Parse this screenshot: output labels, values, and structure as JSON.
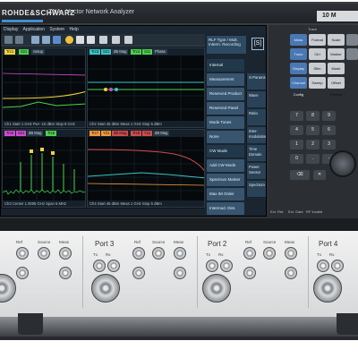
{
  "header": {
    "brand": "ROHDE&SCHWARZ",
    "model": "ZNA · Vector Network Analyzer",
    "model_badge": "10 M"
  },
  "menu": [
    "Display",
    "Application",
    "System",
    "Help"
  ],
  "softkeys": {
    "head": "RLF Type / Mult. Interm. Recording",
    "bracket": "[S]",
    "left": [
      "Internal",
      "Measurement",
      "Reserved Product",
      "Reserved Panel",
      "Mode Tones",
      "None",
      "CW Mode Spectrum",
      "Add CW Mode",
      "Spectrum Marker",
      "Max IM Order",
      "Intermod. Dist. Calc."
    ],
    "right": [
      "S-Params",
      "Wave",
      "Ratio",
      "Inter-modulation",
      "Time Domain",
      "Power Sensor",
      "Spectrum"
    ]
  },
  "traces": {
    "tl_tags": [
      "Trc1",
      "S21",
      "Setup"
    ],
    "tr_tags": [
      "Trc3",
      "S21",
      "dB Mag",
      "Trc4",
      "S11",
      "Phase"
    ],
    "bl_tags": [
      "Trc5",
      "S21",
      "dB Mag",
      "Trc6",
      "S11",
      "Mag"
    ],
    "br_tags": [
      "Trc7",
      "Y21",
      "dB Mag",
      "Trc8",
      "Y11",
      "dB Mag"
    ],
    "tl_foot": "Ch1  Start 1 GHz   Pwr -10 dBm   Stop 8 GHz",
    "tr_foot": "Ch2  Start 45 dBm   Meas 1 GHz  Stop 5 dBm",
    "bl_foot": "Ch3  Center 1.0005 GHz   Span 5 MHz",
    "br_foot": "Ch4  Start 45 dBm   Meas 1 GHz  Stop 5 dBm"
  },
  "panel": {
    "section_labels": [
      "Trace",
      "Ch",
      "Marker",
      "System"
    ],
    "buttons_row1": [
      "Meas",
      "Format",
      "Scale"
    ],
    "buttons_row2": [
      "Trace Config",
      "Ctrl",
      "Marker"
    ],
    "buttons_row3": [
      "Display Config",
      "Stim",
      "Mode"
    ],
    "buttons_row4": [
      "Channel Config",
      "Sweep",
      "Offset Embed"
    ],
    "keys": [
      "7",
      "8",
      "9",
      "4",
      "5",
      "6",
      "1",
      "2",
      "3",
      "0",
      ".",
      "-"
    ],
    "bottom_labels": [
      "Ext. Ref.",
      "Ext. Gate",
      "RF Invalid"
    ]
  },
  "ports": [
    {
      "title": "Port 3",
      "labels": [
        "Ref",
        "Source",
        "Meas"
      ],
      "sub": [
        "Tx",
        "Rx"
      ]
    },
    {
      "title": "Port 2",
      "labels": [
        "Ref",
        "Source",
        "Meas"
      ],
      "sub": [
        "Tx",
        "Rx"
      ]
    },
    {
      "title": "Port 4",
      "labels": [
        "Ref",
        "Source",
        "Meas"
      ],
      "sub": [
        "Tx",
        "Rx"
      ]
    }
  ],
  "colors": {
    "trace_yellow": "#f2d23a",
    "trace_green": "#4cd24c",
    "trace_teal": "#3bc4c4",
    "trace_magenta": "#d24cd2",
    "accent_blue": "#4a78b4"
  }
}
